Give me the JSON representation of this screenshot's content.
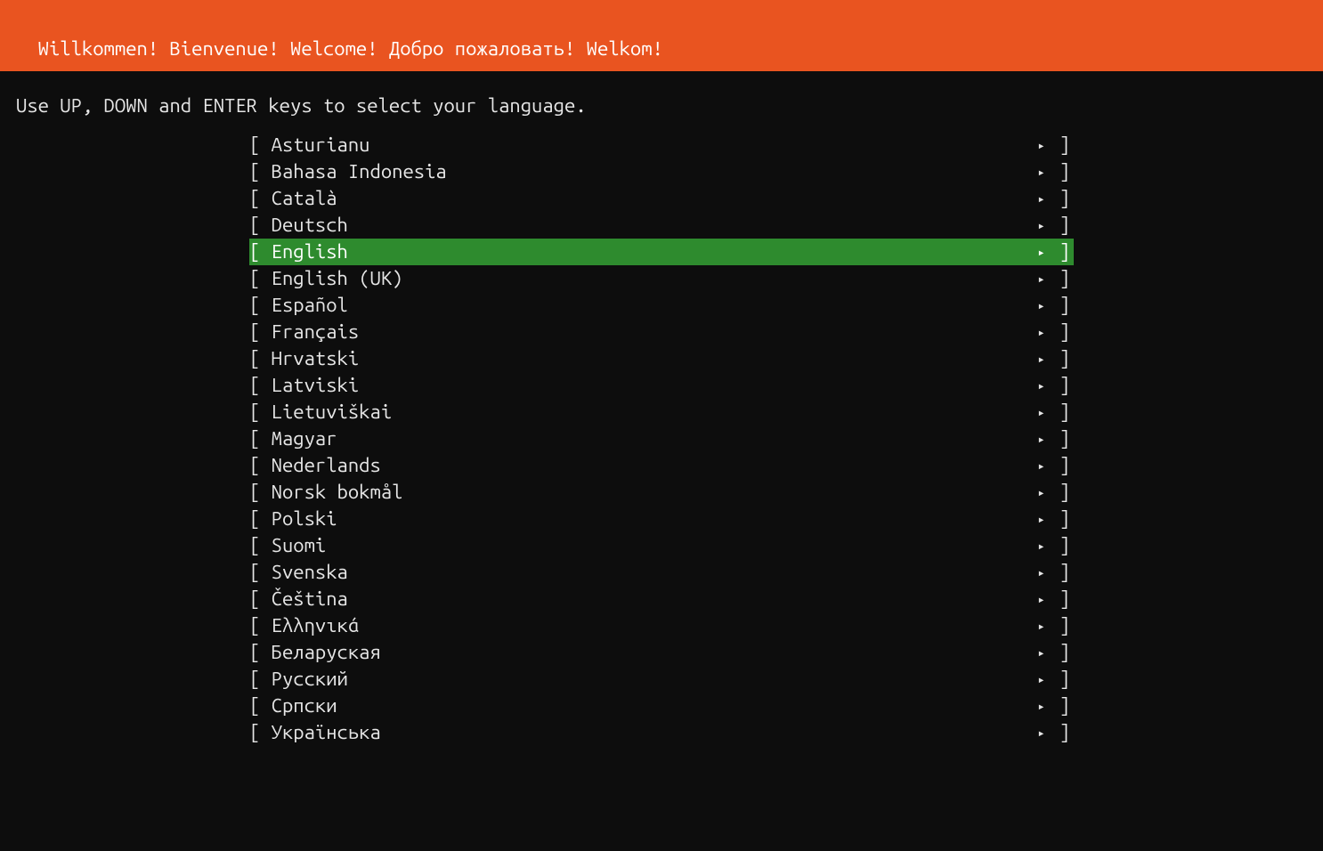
{
  "header": {
    "title": "Willkommen! Bienvenue! Welcome! Добро пожаловать! Welkom!"
  },
  "instructions": "Use UP, DOWN and ENTER keys to select your language.",
  "menu": {
    "bracket_open": "[ ",
    "bracket_close": " ]",
    "arrow": "▸",
    "selected_index": 4,
    "items": [
      {
        "label": "Asturianu"
      },
      {
        "label": "Bahasa Indonesia"
      },
      {
        "label": "Català"
      },
      {
        "label": "Deutsch"
      },
      {
        "label": "English"
      },
      {
        "label": "English (UK)"
      },
      {
        "label": "Español"
      },
      {
        "label": "Français"
      },
      {
        "label": "Hrvatski"
      },
      {
        "label": "Latviski"
      },
      {
        "label": "Lietuviškai"
      },
      {
        "label": "Magyar"
      },
      {
        "label": "Nederlands"
      },
      {
        "label": "Norsk bokmål"
      },
      {
        "label": "Polski"
      },
      {
        "label": "Suomi"
      },
      {
        "label": "Svenska"
      },
      {
        "label": "Čeština"
      },
      {
        "label": "Ελληνικά"
      },
      {
        "label": "Беларуская"
      },
      {
        "label": "Русский"
      },
      {
        "label": "Српски"
      },
      {
        "label": "Українська"
      }
    ]
  }
}
